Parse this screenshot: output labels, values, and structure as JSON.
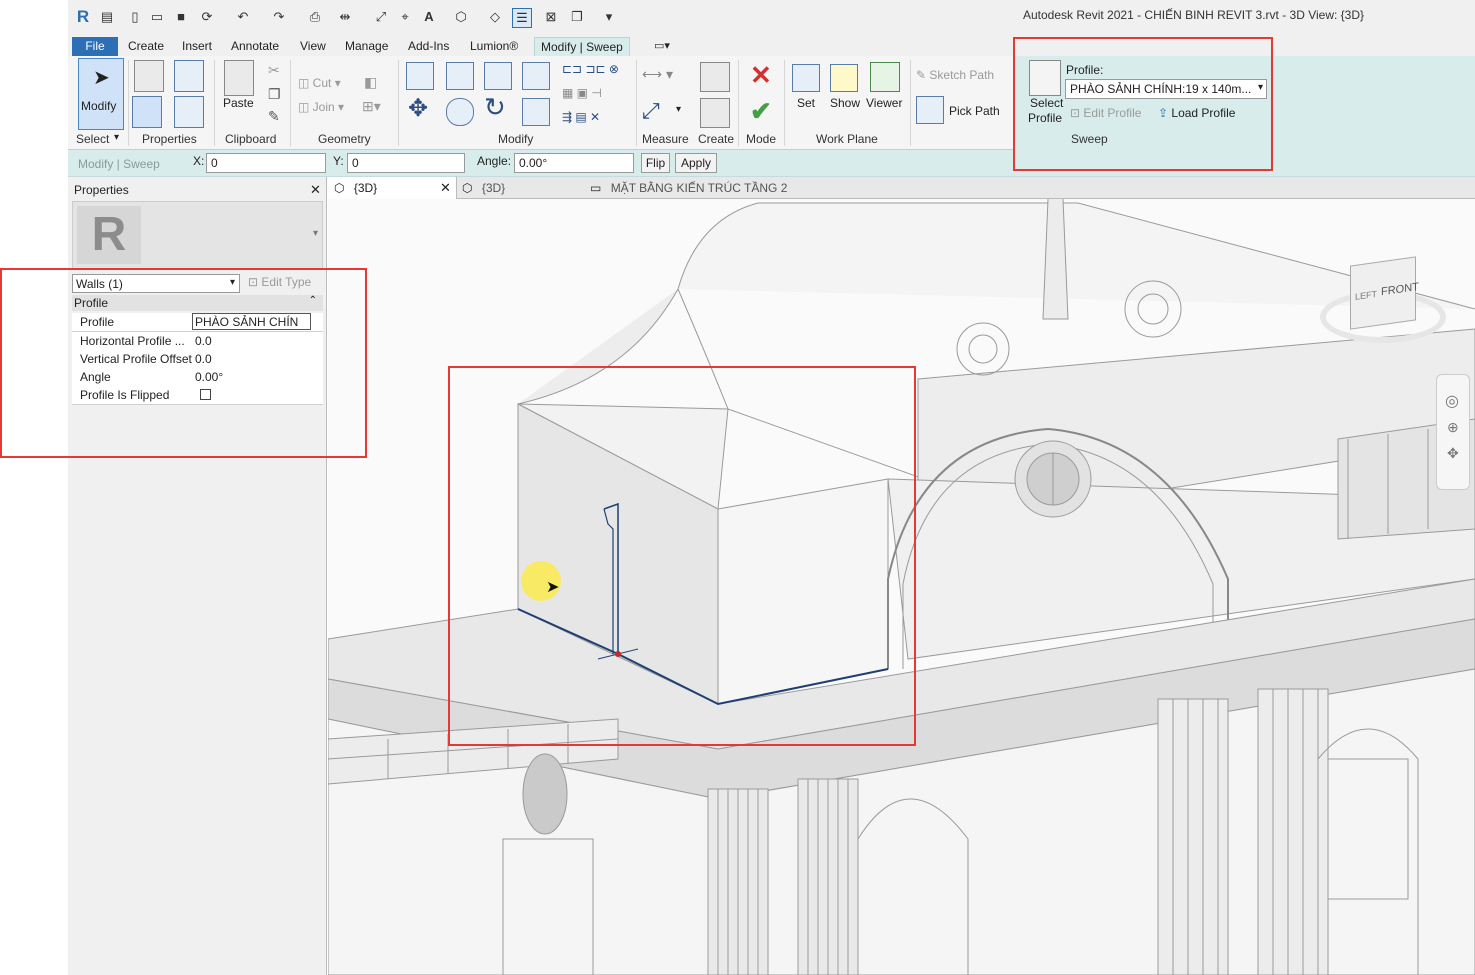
{
  "window": {
    "title": "Autodesk Revit 2021 - CHIẾN BINH REVIT 3.rvt - 3D View: {3D}"
  },
  "ribbon_tabs": [
    "File",
    "Create",
    "Insert",
    "Annotate",
    "View",
    "Manage",
    "Add-Ins",
    "Lumion®",
    "Modify | Sweep"
  ],
  "ribbon": {
    "modify": "Modify",
    "paste": "Paste",
    "cut": "Cut",
    "join": "Join",
    "measure": "Measure",
    "create": "Create",
    "mode": "Mode",
    "set": "Set",
    "show": "Show",
    "viewer": "Viewer",
    "sketch_path": "Sketch Path",
    "pick_path": "Pick Path",
    "select_profile_1": "Select",
    "select_profile_2": "Profile",
    "profile_label": "Profile:",
    "profile_value": "PHÀO SẢNH CHÍNH:19 x 140m...",
    "edit_profile": "Edit Profile",
    "load_profile": "Load Profile",
    "panels": {
      "select": "Select",
      "properties": "Properties",
      "clipboard": "Clipboard",
      "geometry": "Geometry",
      "modify": "Modify",
      "measure": "Measure",
      "create": "Create",
      "mode": "Mode",
      "work_plane": "Work Plane",
      "sweep": "Sweep"
    }
  },
  "options_bar": {
    "context": "Modify | Sweep",
    "x_label": "X:",
    "x_value": "0",
    "y_label": "Y:",
    "y_value": "0",
    "angle_label": "Angle:",
    "angle_value": "0.00°",
    "flip": "Flip",
    "apply": "Apply"
  },
  "properties": {
    "title": "Properties",
    "close": "✕",
    "type_selector": "Walls (1)",
    "edit_type": "Edit Type",
    "section": "Profile",
    "rows": [
      {
        "name": "Profile",
        "value": "PHÀO SẢNH CHÍN"
      },
      {
        "name": "Horizontal Profile ...",
        "value": "0.0"
      },
      {
        "name": "Vertical Profile Offset",
        "value": "0.0"
      },
      {
        "name": "Angle",
        "value": "0.00°"
      },
      {
        "name": "Profile Is Flipped",
        "value": ""
      }
    ]
  },
  "view_tabs": [
    {
      "label": "{3D}",
      "active": true
    },
    {
      "label": "{3D}",
      "active": false
    },
    {
      "label": "MẶT BẰNG KIẾN TRÚC TẦNG 2",
      "active": false
    }
  ],
  "viewcube": {
    "front": "FRONT",
    "left": "LEFT"
  },
  "colors": {
    "accent": "#2d6fb6",
    "context_tab": "#d8ecec",
    "highlight_box": "#e53935",
    "sketch_line": "#1f3f73"
  }
}
